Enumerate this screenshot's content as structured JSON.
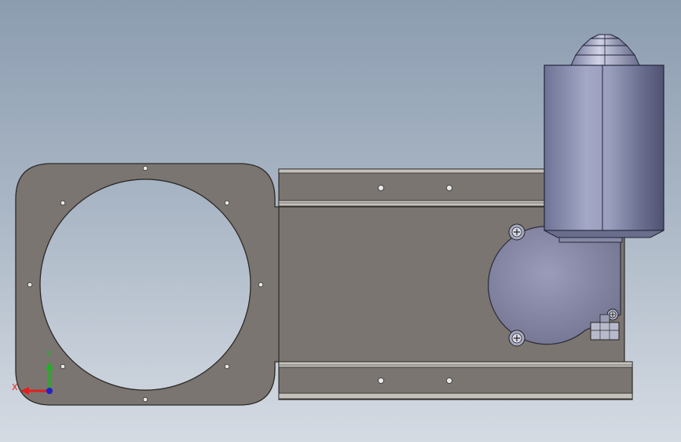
{
  "viewport": {
    "background_top": "#8c9db0",
    "background_bottom": "#d5dbe3"
  },
  "model": {
    "plate_color": "#7a7570",
    "plate_edge_color": "#2c2a28",
    "motor_body_color": "#8a8fb0",
    "gearbox_color": "#8a8ca8"
  },
  "triad": {
    "x_label": "X",
    "y_label": "Y",
    "x_color": "#e02020",
    "y_color": "#20b020",
    "z_color": "#2020d0"
  }
}
